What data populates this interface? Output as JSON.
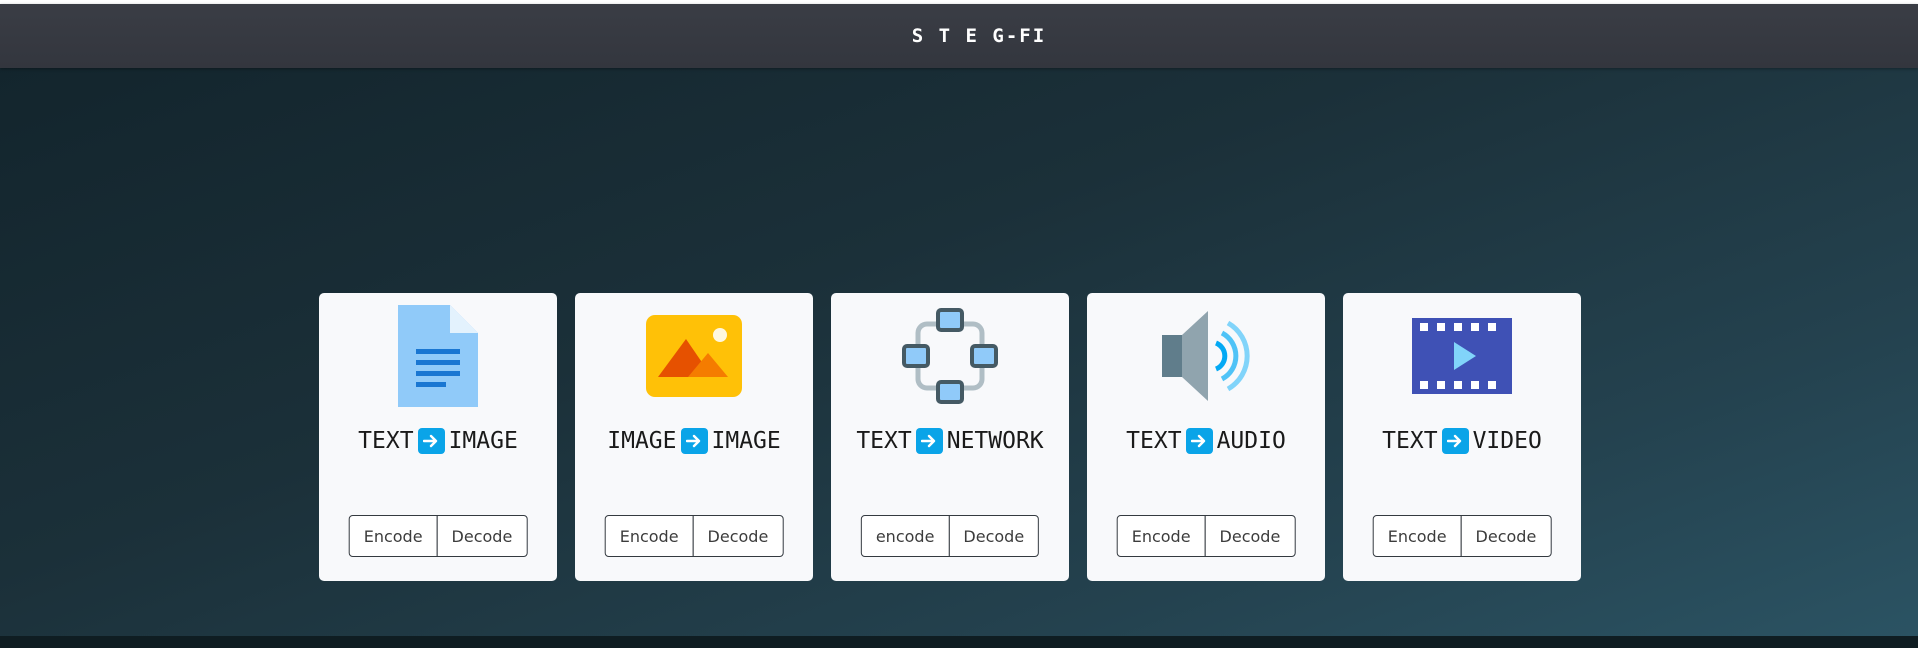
{
  "navbar": {
    "brand": "S T E G-FI"
  },
  "colors": {
    "navbar": "#373a42",
    "hero_start": "#13252d",
    "hero_end": "#2b5363",
    "card_bg": "#f8f9fb",
    "arrow_badge": "#0aa4e8"
  },
  "cards": [
    {
      "icon": "document-icon",
      "from": "TEXT",
      "to": "IMAGE",
      "encode_label": "Encode",
      "decode_label": "Decode"
    },
    {
      "icon": "image-icon",
      "from": "IMAGE",
      "to": "IMAGE",
      "encode_label": "Encode",
      "decode_label": "Decode"
    },
    {
      "icon": "network-icon",
      "from": "TEXT",
      "to": "NETWORK",
      "encode_label": "encode",
      "decode_label": "Decode"
    },
    {
      "icon": "speaker-icon",
      "from": "TEXT",
      "to": "AUDIO",
      "encode_label": "Encode",
      "decode_label": "Decode"
    },
    {
      "icon": "video-icon",
      "from": "TEXT",
      "to": "VIDEO",
      "encode_label": "Encode",
      "decode_label": "Decode"
    }
  ]
}
